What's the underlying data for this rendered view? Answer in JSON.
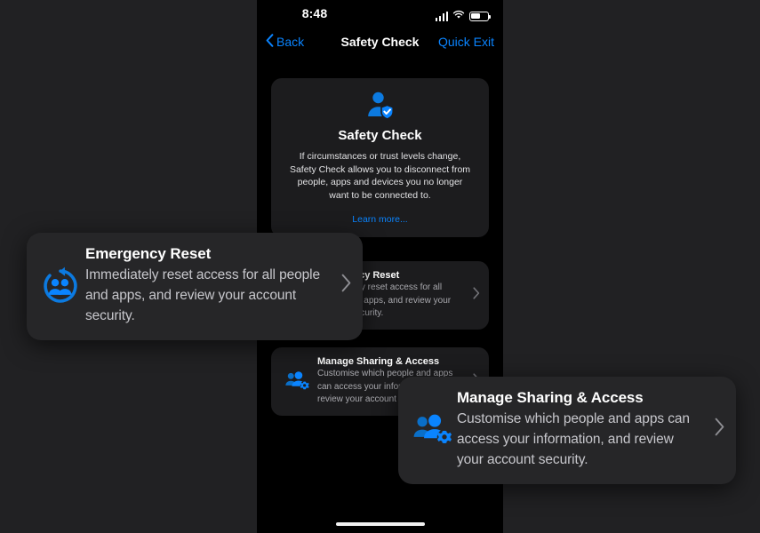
{
  "status_bar": {
    "time": "8:48",
    "cellular_icon": "cellular-bars-icon",
    "wifi_icon": "wifi-icon",
    "battery_icon": "battery-icon"
  },
  "nav_bar": {
    "back_label": "Back",
    "back_icon": "chevron-left-icon",
    "title": "Safety Check",
    "quick_exit_label": "Quick Exit"
  },
  "hero": {
    "icon": "person-shield-check-icon",
    "title": "Safety Check",
    "body": "If circumstances or trust levels change, Safety Check allows you to disconnect from people, apps and devices you no longer want to be connected to.",
    "link_label": "Learn more..."
  },
  "rows": [
    {
      "icon": "emergency-reset-icon",
      "title": "Emergency Reset",
      "desc": "Immediately reset access for all people and apps, and review your account security.",
      "chevron": "chevron-right-icon"
    },
    {
      "icon": "manage-sharing-icon",
      "title": "Manage Sharing & Access",
      "desc": "Customise which people and apps can access your information, and review your account security.",
      "chevron": "chevron-right-icon"
    }
  ],
  "tooltips": [
    {
      "icon": "emergency-reset-icon",
      "title": "Emergency Reset",
      "desc": "Immediately reset access for all people and apps, and review your account security.",
      "chevron": "chevron-right-icon"
    },
    {
      "icon": "manage-sharing-icon",
      "title": "Manage Sharing & Access",
      "desc": "Customise which people and apps can access your information, and review your account security.",
      "chevron": "chevron-right-icon"
    }
  ],
  "colors": {
    "accent_blue": "#0a84ff",
    "icon_blue": "#0c7ae0",
    "card_background": "#1c1c1e",
    "tooltip_background": "#262628",
    "screen_background": "#000000",
    "page_background": "#212123"
  },
  "home_indicator": "home-indicator"
}
